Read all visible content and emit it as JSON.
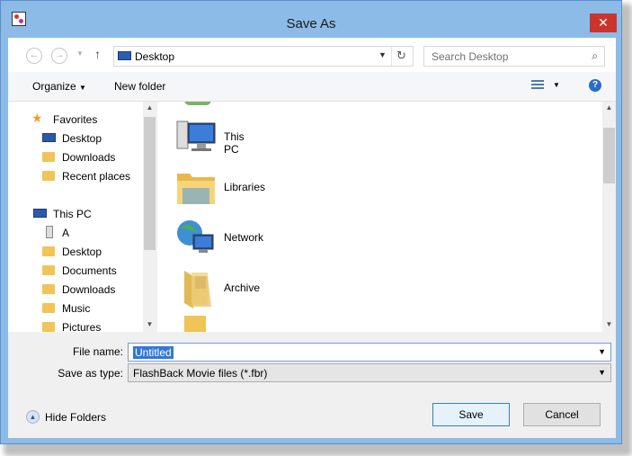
{
  "window": {
    "title": "Save As"
  },
  "nav": {
    "address": "Desktop",
    "search_placeholder": "Search Desktop"
  },
  "toolbar": {
    "organize": "Organize",
    "new_folder": "New folder"
  },
  "sidebar": {
    "favorites": {
      "label": "Favorites",
      "items": [
        "Desktop",
        "Downloads",
        "Recent places"
      ]
    },
    "this_pc": {
      "label": "This PC",
      "items": [
        "A",
        "Desktop",
        "Documents",
        "Downloads",
        "Music",
        "Pictures"
      ]
    }
  },
  "main": {
    "items": [
      "This PC",
      "Libraries",
      "Network",
      "Archive"
    ]
  },
  "form": {
    "file_name_label": "File name:",
    "file_name_value": "Untitled",
    "save_type_label": "Save as type:",
    "save_type_value": "FlashBack Movie files (*.fbr)"
  },
  "footer": {
    "hide_folders": "Hide Folders",
    "save": "Save",
    "cancel": "Cancel"
  },
  "colors": {
    "frame": "#8dbbe8",
    "close": "#c7372f",
    "selection": "#3278d6"
  }
}
